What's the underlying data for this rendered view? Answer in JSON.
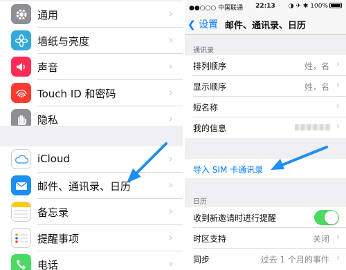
{
  "left": {
    "items": [
      {
        "label": "通用",
        "icon": "gear-icon",
        "color": "#8e8e93"
      },
      {
        "label": "墙纸与亮度",
        "icon": "flower-icon",
        "color": "#34aadc"
      },
      {
        "label": "声音",
        "icon": "speaker-icon",
        "color": "#ff2d55"
      },
      {
        "label": "Touch ID 和密码",
        "icon": "fingerprint-icon",
        "color": "#ff3b30"
      },
      {
        "label": "隐私",
        "icon": "hand-icon",
        "color": "#8e8e93"
      },
      {
        "label": "iCloud",
        "icon": "cloud-icon",
        "color": "#ffffff"
      },
      {
        "label": "邮件、通讯录、日历",
        "icon": "mail-icon",
        "color": "#1f8ef1"
      },
      {
        "label": "备忘录",
        "icon": "notes-icon",
        "color": "#ffcc00"
      },
      {
        "label": "提醒事项",
        "icon": "list-icon",
        "color": "#ffffff"
      },
      {
        "label": "电话",
        "icon": "phone-icon",
        "color": "#4cd964"
      }
    ]
  },
  "right": {
    "status": {
      "carrier": "●●○○○ 中国联通",
      "time": "22:13",
      "battery": "100%"
    },
    "nav": {
      "back": "设置",
      "title": "邮件、通讯录、日历"
    },
    "contacts_header": "通讯录",
    "contacts_rows": [
      {
        "label": "排列顺序",
        "value": "姓，名"
      },
      {
        "label": "显示顺序",
        "value": "姓，名"
      },
      {
        "label": "短名称",
        "value": ""
      },
      {
        "label": "我的信息",
        "value": ""
      }
    ],
    "import_sim": "导入 SIM 卡通讯录",
    "calendar_header": "日历",
    "calendar_rows": [
      {
        "label": "收到新邀请时进行提醒",
        "value": ""
      },
      {
        "label": "时区支持",
        "value": "关闭"
      },
      {
        "label": "同步",
        "value": "过去 1 个月的事件"
      }
    ]
  },
  "colors": {
    "accent": "#007aff",
    "arrow": "#1f8ef1",
    "toggle_on": "#4cd964"
  }
}
